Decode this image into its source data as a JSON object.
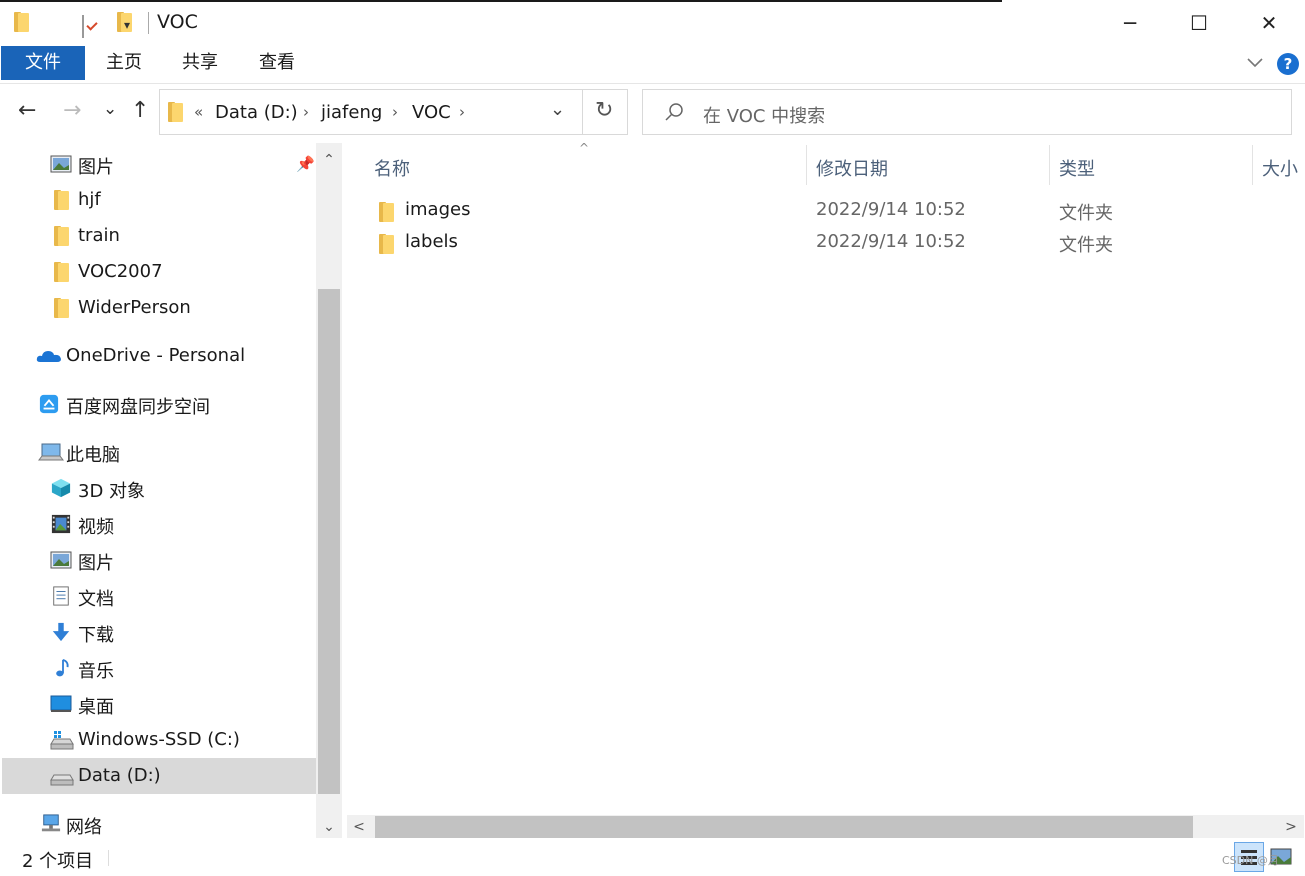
{
  "window": {
    "title": "VOC",
    "minimize_glyph": "─",
    "maximize_glyph": "☐",
    "close_glyph": "✕",
    "quick_access_arrow": "▾"
  },
  "ribbon": {
    "tabs": [
      "文件",
      "主页",
      "共享",
      "查看"
    ],
    "help_label": "?"
  },
  "nav_buttons": {
    "back": "←",
    "forward": "→",
    "recent": "⌄",
    "up": "↑"
  },
  "address": {
    "overflow": "«",
    "crumbs": [
      "Data (D:)",
      "jiafeng",
      "VOC"
    ],
    "separator": "›",
    "dropdown_glyph": "⌄",
    "refresh_glyph": "↻"
  },
  "search": {
    "placeholder": "在 VOC 中搜索"
  },
  "nav_pane": {
    "pin_glyph": "📌",
    "items": [
      {
        "label": "图片",
        "icon": "pictures-icon"
      },
      {
        "label": "hjf",
        "icon": "folder-icon"
      },
      {
        "label": "train",
        "icon": "folder-icon"
      },
      {
        "label": "VOC2007",
        "icon": "folder-icon"
      },
      {
        "label": "WiderPerson",
        "icon": "folder-icon"
      },
      {
        "label": "OneDrive - Personal",
        "icon": "onedrive-icon"
      },
      {
        "label": "百度网盘同步空间",
        "icon": "baidu-netdisk-icon"
      },
      {
        "label": "此电脑",
        "icon": "this-pc-icon"
      },
      {
        "label": "3D 对象",
        "icon": "3d-objects-icon"
      },
      {
        "label": "视频",
        "icon": "videos-icon"
      },
      {
        "label": "图片",
        "icon": "pictures-icon"
      },
      {
        "label": "文档",
        "icon": "documents-icon"
      },
      {
        "label": "下载",
        "icon": "downloads-icon"
      },
      {
        "label": "音乐",
        "icon": "music-icon"
      },
      {
        "label": "桌面",
        "icon": "desktop-icon"
      },
      {
        "label": "Windows-SSD (C:)",
        "icon": "drive-c-icon"
      },
      {
        "label": "Data (D:)",
        "icon": "drive-d-icon"
      },
      {
        "label": "网络",
        "icon": "network-icon"
      }
    ],
    "scroll_up": "⌃",
    "scroll_down": "⌄"
  },
  "file_list": {
    "columns": [
      "名称",
      "修改日期",
      "类型",
      "大小"
    ],
    "sort_caret": "^",
    "rows": [
      {
        "name": "images",
        "date": "2022/9/14 10:52",
        "type": "文件夹"
      },
      {
        "name": "labels",
        "date": "2022/9/14 10:52",
        "type": "文件夹"
      }
    ],
    "scroll_left": "<",
    "scroll_right": ">"
  },
  "status": {
    "item_count": "2 个项目",
    "watermark": "CSDN @月"
  },
  "colors": {
    "file_tab": "#1a64b8",
    "header_text": "#4c607a",
    "selection": "#d9d9d9",
    "help": "#1a6fd0"
  }
}
